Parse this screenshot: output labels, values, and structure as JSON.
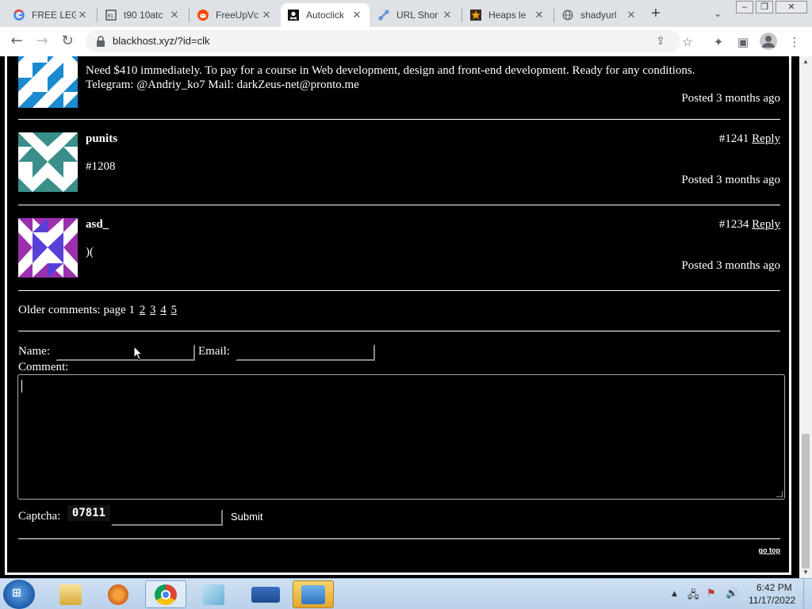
{
  "browser": {
    "tabs": [
      {
        "title": "FREE LEG",
        "icon": "google-icon",
        "active": false
      },
      {
        "title": "t90 10atc",
        "icon": "site-icon",
        "active": false
      },
      {
        "title": "FreeUpVc",
        "icon": "reddit-icon",
        "active": false
      },
      {
        "title": "Autoclick",
        "icon": "pirate-flag-icon",
        "active": true
      },
      {
        "title": "URL Shor",
        "icon": "link-icon",
        "active": false
      },
      {
        "title": "Heaps le",
        "icon": "star-icon",
        "active": false
      },
      {
        "title": "shadyurl",
        "icon": "globe-icon",
        "active": false
      }
    ],
    "url": "blackhost.xyz/?id=clk"
  },
  "comments": [
    {
      "body_line1": "Need $410 immediately. To pay for a course in Web development, design and front-end development. Ready for any conditions.",
      "body_line2": "Telegram: @Andriy_ko7 Mail: darkZeus-net@pronto.me",
      "posted": "Posted 3 months ago"
    },
    {
      "author": "punits",
      "number": "#1241",
      "reply": "Reply",
      "body": "#1208",
      "posted": "Posted 3 months ago"
    },
    {
      "author": "asd_",
      "number": "#1234",
      "reply": "Reply",
      "body": ")(",
      "posted": "Posted 3 months ago"
    }
  ],
  "pagination": {
    "label": "Older comments: page",
    "current": "1",
    "pages": [
      "2",
      "3",
      "4",
      "5"
    ]
  },
  "form": {
    "name_label": "Name:",
    "email_label": "Email:",
    "comment_label": "Comment:",
    "captcha_label": "Captcha:",
    "captcha_text": "07811",
    "submit_label": "Submit",
    "go_top": "go top"
  },
  "taskbar": {
    "time": "6:42 PM",
    "date": "11/17/2022"
  }
}
